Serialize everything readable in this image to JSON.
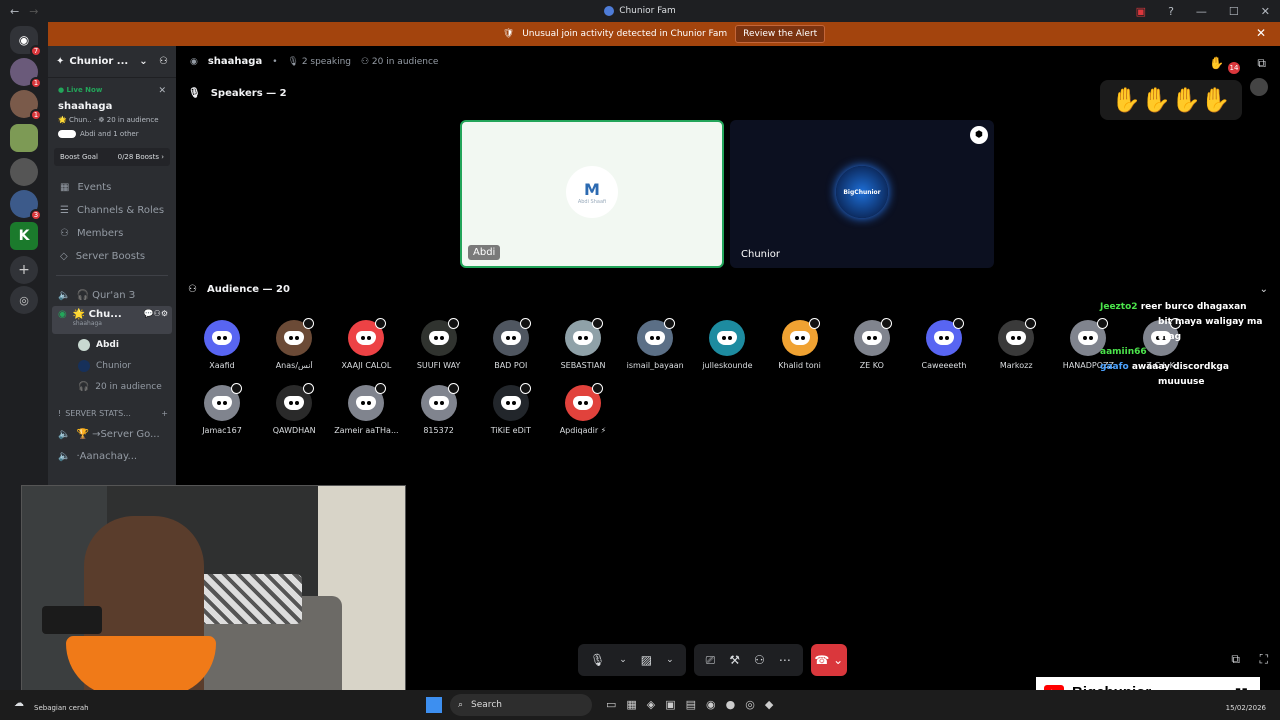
{
  "window": {
    "title": "Chunior Fam"
  },
  "alert": {
    "text": "Unusual join activity detected in Chunior Fam",
    "button": "Review the Alert"
  },
  "rail": {
    "badges": [
      "7",
      "1",
      "1",
      "3"
    ]
  },
  "sidebar": {
    "server_name": "Chunior ...",
    "live": {
      "label": "Live Now",
      "title": "shaahaga",
      "meta": "🌟 Chun.. · ☸ 20 in audience",
      "listeners": "Abdi and 1 other"
    },
    "boost": {
      "label": "Boost Goal",
      "value": "0/28 Boosts"
    },
    "nav": [
      {
        "icon": "calendar-icon",
        "label": "Events"
      },
      {
        "icon": "channels-roles-icon",
        "label": "Channels & Roles"
      },
      {
        "icon": "members-icon",
        "label": "Members"
      },
      {
        "icon": "boost-icon",
        "label": "Server Boosts"
      }
    ],
    "channels": [
      {
        "icon": "speaker-icon",
        "label": "🎧 Qur'an З"
      },
      {
        "icon": "stage-icon",
        "label": "🌟 Chu...",
        "sub": "shaahaga"
      }
    ],
    "stage_users": [
      "Abdi",
      "Chunior"
    ],
    "stage_audience": "20 in audience",
    "category": "SERVER STATS...",
    "stats_channels": [
      "🏆 →Server Go...",
      "·Aanachay..."
    ]
  },
  "stage": {
    "name": "shaahaga",
    "speaking": "2 speaking",
    "audience_count": "20 in audience",
    "speakers_title": "Speakers — 2",
    "speakers": [
      {
        "name": "Abdi",
        "logo_text": "Abdi Shaafi"
      },
      {
        "name": "Chunior",
        "logo_text": "BigChunior"
      }
    ],
    "audience_title": "Audience — 20",
    "audience": [
      {
        "name": "Xaafid",
        "color": "#5865f2"
      },
      {
        "name": "Anas/أنس",
        "color": "#6b4a36"
      },
      {
        "name": "XAAJI CALOL",
        "color": "#ed4245"
      },
      {
        "name": "SUUFI WAY",
        "color": "#30332f"
      },
      {
        "name": "BAD POI",
        "color": "#4f5660"
      },
      {
        "name": "SEBASTIAN",
        "color": "#8fa1a8"
      },
      {
        "name": "ismail_bayaan",
        "color": "#5b6f86"
      },
      {
        "name": "julleskounde",
        "color": "#1d8ba0"
      },
      {
        "name": "Khalid toni",
        "color": "#f0a232"
      },
      {
        "name": "ZE KO",
        "color": "#80848e"
      },
      {
        "name": "Caweeeeth",
        "color": "#5865f2"
      },
      {
        "name": "Markozz",
        "color": "#3a3a3a"
      },
      {
        "name": "HANADPOZZ",
        "color": "#80848e"
      },
      {
        "name": "Z-C L K",
        "color": "#80848e"
      },
      {
        "name": "Jamac167",
        "color": "#80848e"
      },
      {
        "name": "QAWDHAN",
        "color": "#2a2a2a"
      },
      {
        "name": "Zameir aaTHa...",
        "color": "#80848e"
      },
      {
        "name": "815372",
        "color": "#80848e"
      },
      {
        "name": "TiKiE eDiT",
        "color": "#22262b"
      },
      {
        "name": "Apdiqadir ⚡",
        "color": "#e1423c"
      }
    ]
  },
  "hands": "✋✋✋✋",
  "chat": [
    {
      "user": "Jeezto2",
      "text": "reer burco dhagaxan"
    },
    {
      "user": "",
      "text": "bit maya waligay ma"
    },
    {
      "user": "",
      "text": "arag"
    },
    {
      "user": "aamiin66",
      "text": ""
    },
    {
      "user": "gaafo",
      "text": "awaaay discordkga"
    },
    {
      "user": "",
      "text": "muuuuse"
    }
  ],
  "taskbar": {
    "weather": "Sebagian cerah",
    "search": "Search",
    "date": "15/02/2026"
  },
  "youtube": {
    "channel": "Bigchunior"
  },
  "colors": {
    "alert": "#a3440d",
    "discord_blurple": "#5865f2",
    "red": "#da373c",
    "green": "#23a55a"
  }
}
